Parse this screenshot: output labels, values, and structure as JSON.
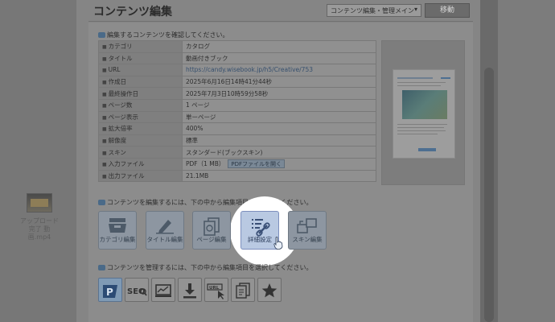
{
  "header": {
    "title": "コンテンツ編集",
    "select_value": "コンテンツ編集・管理メイン",
    "move_button": "移動"
  },
  "info_confirm": "編集するコンテンツを確認してください。",
  "properties": [
    {
      "label": "カテゴリ",
      "value": "カタログ"
    },
    {
      "label": "タイトル",
      "value": "動画付きブック"
    },
    {
      "label": "URL",
      "value": "https://candy.wisebook.jp/h5/Creative/753"
    },
    {
      "label": "作成日",
      "value": "2025年6月16日14時41分44秒"
    },
    {
      "label": "最終操作日",
      "value": "2025年7月3日10時59分58秒"
    },
    {
      "label": "ページ数",
      "value": "1 ページ"
    },
    {
      "label": "ページ表示",
      "value": "単ーページ"
    },
    {
      "label": "拡大倍率",
      "value": "400%"
    },
    {
      "label": "解像度",
      "value": "標準"
    },
    {
      "label": "スキン",
      "value": "スタンダード(ブックスキン)"
    },
    {
      "label": "入力ファイル",
      "value": "PDF（1 MB）"
    },
    {
      "label": "出力ファイル",
      "value": "21.1MB"
    }
  ],
  "pdf_button": "PDFファイルを開く",
  "info_edit": "コンテンツを編集するには、下の中から編集項目を選択してください。",
  "edit_buttons": [
    {
      "label": "カテゴリ編集",
      "icon": "tray-icon"
    },
    {
      "label": "タイトル編集",
      "icon": "pencil-icon"
    },
    {
      "label": "ページ編集",
      "icon": "pages-icon"
    },
    {
      "label": "詳細設定",
      "icon": "link-settings-icon"
    },
    {
      "label": "スキン編集",
      "icon": "skin-icon"
    }
  ],
  "info_manage": "コンテンツを管理するには、下の中から編集項目を選択してください。",
  "manage_buttons": [
    {
      "icon": "publish-icon",
      "text": "P"
    },
    {
      "icon": "seo-icon",
      "text": "SEO"
    },
    {
      "icon": "analytics-icon"
    },
    {
      "icon": "download-icon"
    },
    {
      "icon": "url-icon",
      "text": "URL"
    },
    {
      "icon": "copy-icon"
    },
    {
      "icon": "star-icon"
    }
  ],
  "desktop_icon": {
    "label": "アップロード完了 動画.mp4"
  },
  "colors": {
    "highlight": "#ffffff",
    "accent": "#b9c9e2"
  }
}
